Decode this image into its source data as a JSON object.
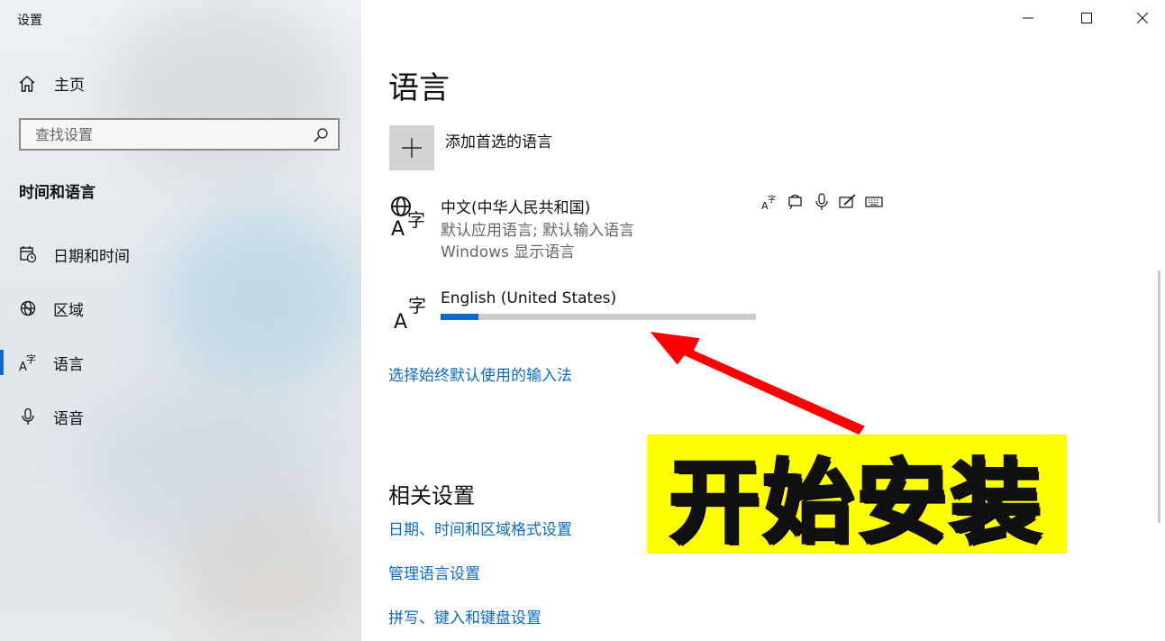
{
  "window": {
    "title": "设置"
  },
  "sidebar": {
    "home_label": "主页",
    "search_placeholder": "查找设置",
    "section_header": "时间和语言",
    "items": [
      {
        "label": "日期和时间",
        "icon": "calendar-clock-icon"
      },
      {
        "label": "区域",
        "icon": "globe-region-icon"
      },
      {
        "label": "语言",
        "icon": "language-icon",
        "active": true
      },
      {
        "label": "语音",
        "icon": "microphone-icon"
      }
    ]
  },
  "main": {
    "page_title": "语言",
    "add_language_label": "添加首选的语言",
    "languages": [
      {
        "name": "中文(中华人民共和国)",
        "detail1": "默认应用语言; 默认输入语言",
        "detail2": "Windows 显示语言",
        "features": [
          "display-language-icon",
          "speech-recognition-icon",
          "microphone-icon",
          "handwriting-icon",
          "keyboard-icon"
        ]
      },
      {
        "name": "English (United States)",
        "install_progress": 0.12
      }
    ],
    "input_method_link": "选择始终默认使用的输入法",
    "related_title": "相关设置",
    "related_links": [
      "日期、时间和区域格式设置",
      "管理语言设置",
      "拼写、键入和键盘设置"
    ]
  },
  "overlay": {
    "banner_text": "开始安装",
    "banner_color": "#ffff00",
    "arrow_color": "#ff0000"
  },
  "colors": {
    "accent": "#0a6cc8",
    "progress_track": "#cccccc"
  }
}
